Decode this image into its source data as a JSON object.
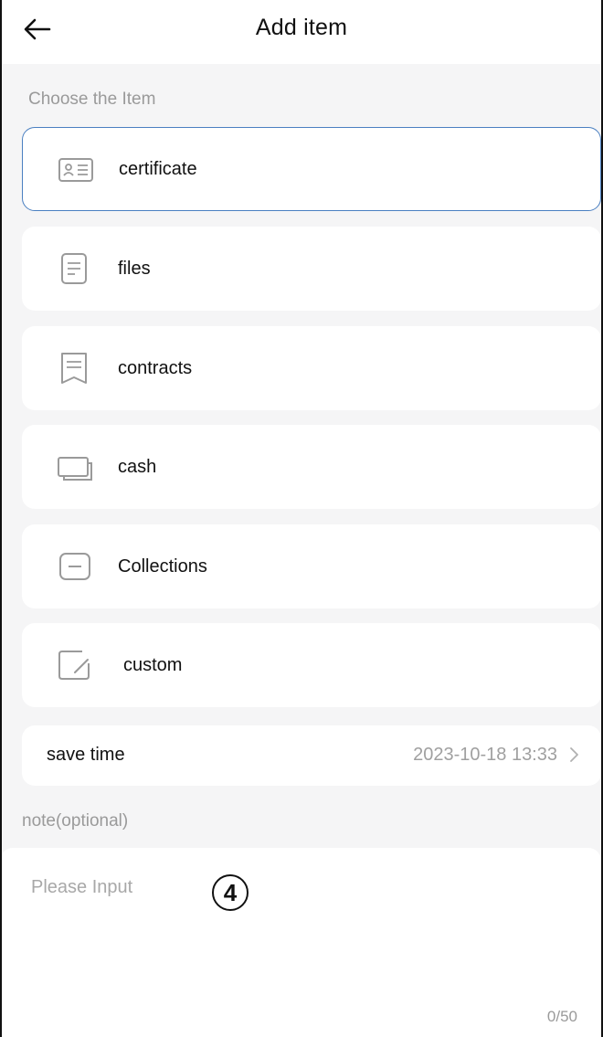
{
  "header": {
    "title": "Add item"
  },
  "choose_label": "Choose the Item",
  "items": [
    {
      "label": "certificate",
      "icon": "id-card-icon",
      "selected": true
    },
    {
      "label": "files",
      "icon": "document-icon",
      "selected": false
    },
    {
      "label": "contracts",
      "icon": "contract-icon",
      "selected": false
    },
    {
      "label": "cash",
      "icon": "cash-icon",
      "selected": false
    },
    {
      "label": "Collections",
      "icon": "collection-box-icon",
      "selected": false
    },
    {
      "label": "custom",
      "icon": "edit-icon",
      "selected": false
    }
  ],
  "save_time": {
    "label": "save time",
    "value": "2023-10-18 13:33"
  },
  "note": {
    "label": "note(optional)",
    "placeholder": "Please Input",
    "counter": "0/50"
  },
  "marker": "4",
  "colors": {
    "accent": "#4a7fc1",
    "icon": "#9a9a9a",
    "background": "#f5f5f6"
  }
}
